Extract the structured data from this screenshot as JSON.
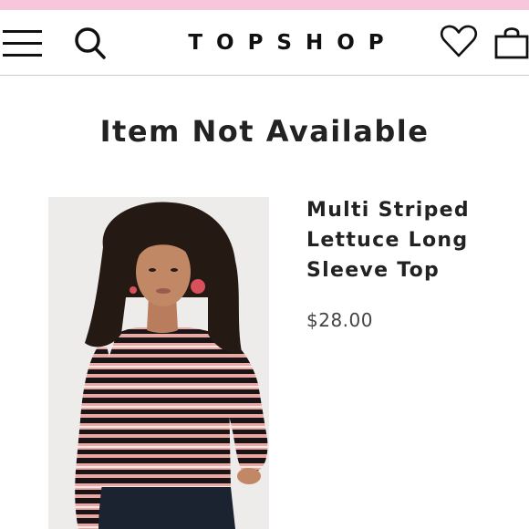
{
  "header": {
    "logo": "TOPSHOP",
    "icons": {
      "menu": "hamburger-menu-icon",
      "search": "search-icon",
      "wishlist": "heart-icon",
      "bag": "shopping-bag-icon"
    }
  },
  "page": {
    "title": "Item Not Available"
  },
  "product": {
    "name": "Multi Striped Lettuce Long Sleeve Top",
    "price": "$28.00"
  },
  "colors": {
    "promo_strip": "#f7c6dc",
    "stripe_pink": "#e8a8a4",
    "stripe_black": "#1a1416",
    "text": "#222222"
  }
}
